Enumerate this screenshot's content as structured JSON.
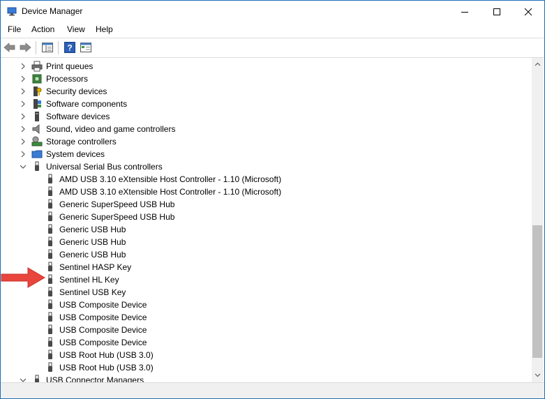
{
  "window": {
    "title": "Device Manager"
  },
  "menu": [
    "File",
    "Action",
    "View",
    "Help"
  ],
  "tree": {
    "categories_above": [
      "Print queues",
      "Processors",
      "Security devices",
      "Software components",
      "Software devices",
      "Sound, video and game controllers",
      "Storage controllers",
      "System devices"
    ],
    "expanded_category": "Universal Serial Bus controllers",
    "usb_devices": [
      "AMD USB 3.10 eXtensible Host Controller - 1.10 (Microsoft)",
      "AMD USB 3.10 eXtensible Host Controller - 1.10 (Microsoft)",
      "Generic SuperSpeed USB Hub",
      "Generic SuperSpeed USB Hub",
      "Generic USB Hub",
      "Generic USB Hub",
      "Generic USB Hub",
      "Sentinel HASP Key",
      "Sentinel HL Key",
      "Sentinel USB Key",
      "USB Composite Device",
      "USB Composite Device",
      "USB Composite Device",
      "USB Composite Device",
      "USB Root Hub (USB 3.0)",
      "USB Root Hub (USB 3.0)"
    ],
    "next_category": "USB Connector Managers"
  },
  "colors": {
    "accent": "#1e6fb8",
    "arrow": "#e8453c",
    "usb_icon": "#4a4a4a"
  }
}
